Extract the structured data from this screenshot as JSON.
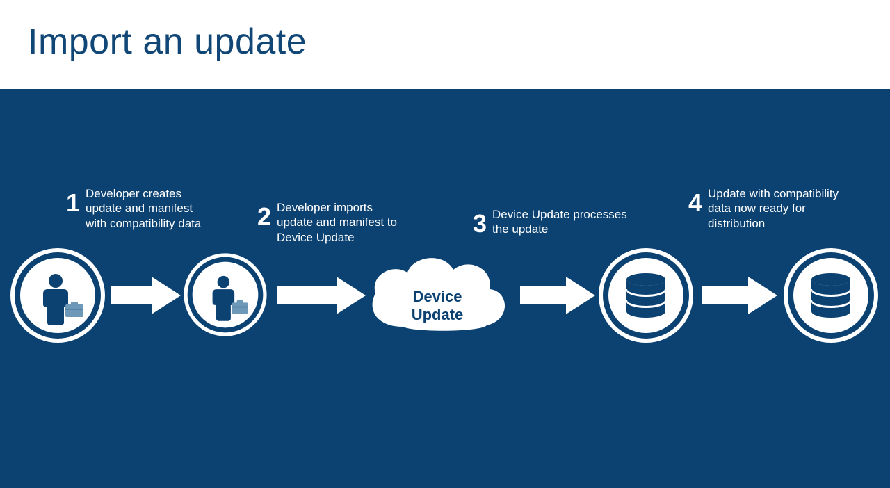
{
  "title": "Import an update",
  "cloud_label": "Device Update",
  "steps": [
    {
      "num": "1",
      "text": "Developer creates update and manifest with compatibility data"
    },
    {
      "num": "2",
      "text": "Developer imports update and manifest to Device Update"
    },
    {
      "num": "3",
      "text": "Device Update processes the update"
    },
    {
      "num": "4",
      "text": "Update with compatibility data now ready for distribution"
    }
  ],
  "colors": {
    "bg": "#0c4272",
    "white": "#ffffff",
    "accent": "#6e98b7"
  }
}
